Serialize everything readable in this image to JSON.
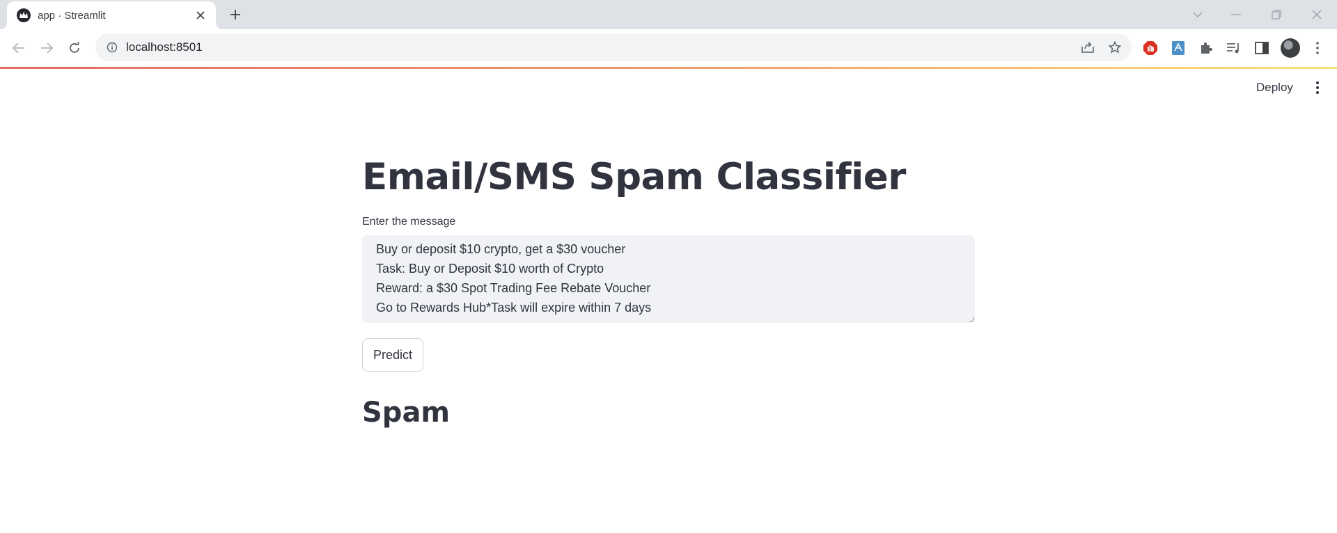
{
  "browser": {
    "tab_title": "app · Streamlit",
    "url": "localhost:8501"
  },
  "icons": {
    "favicon": "streamlit-crown-icon",
    "tab_close": "close-icon",
    "new_tab": "plus-icon",
    "back": "arrow-left-icon",
    "forward": "arrow-right-icon",
    "reload": "reload-icon",
    "site_info": "info-icon",
    "share": "share-icon",
    "bookmark": "star-icon",
    "extensions": [
      "adblock-icon",
      "translate-icon",
      "puzzle-icon",
      "media-queue-icon",
      "side-panel-icon"
    ],
    "menu": "kebab-icon"
  },
  "app_header": {
    "deploy_label": "Deploy"
  },
  "main": {
    "title": "Email/SMS Spam Classifier",
    "input_label": "Enter the message",
    "message_lines": [
      "Buy or deposit $10 crypto, get a $30 voucher",
      "Task: Buy or Deposit $10 worth of Crypto",
      "Reward: a $30 Spot Trading Fee Rebate Voucher",
      "Go to Rewards Hub*Task will expire within 7 days"
    ],
    "predict_label": "Predict",
    "result": "Spam"
  },
  "colors": {
    "tabstrip": "#dee1e6",
    "textarea_bg": "#f0f2f6",
    "text": "#31333f",
    "accent_gradient_start": "#e46a66",
    "accent_gradient_end": "#f9e27c"
  }
}
